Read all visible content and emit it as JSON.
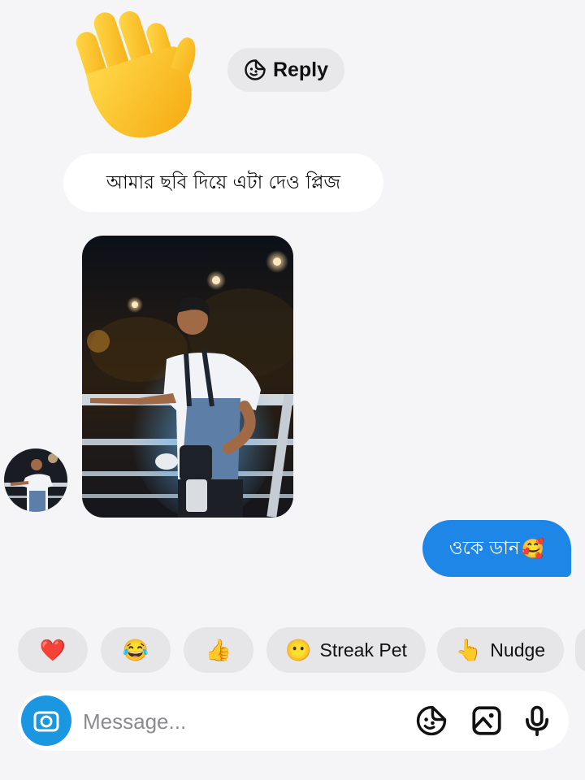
{
  "reply": {
    "label": "Reply",
    "icon": "sticker-icon"
  },
  "messages": {
    "incoming_text": "আমার ছবি দিয়ে এটা দেও প্লিজ",
    "outgoing_text": "ওকে ডান",
    "outgoing_emoji": "🥰"
  },
  "chips": [
    {
      "emoji": "❤️",
      "label": ""
    },
    {
      "emoji": "😂",
      "label": ""
    },
    {
      "emoji": "👍",
      "label": ""
    },
    {
      "emoji": "😶",
      "label": "Streak Pet"
    },
    {
      "emoji": "👆",
      "label": "Nudge"
    }
  ],
  "compose": {
    "placeholder": "Message...",
    "value": ""
  },
  "icons": {
    "wave": "waving-hand-icon",
    "camera": "camera-icon",
    "sticker": "sticker-icon",
    "gallery": "gallery-icon",
    "mic": "microphone-icon"
  },
  "colors": {
    "accent": "#1e86e6",
    "background": "#f5f5f7",
    "chip_bg": "#e6e6e9"
  }
}
